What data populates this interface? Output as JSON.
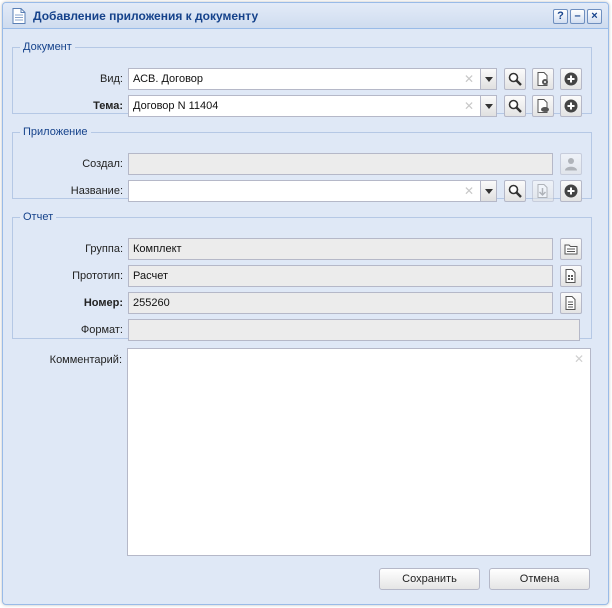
{
  "window": {
    "title": "Добавление приложения к документу"
  },
  "document_group": {
    "legend": "Документ",
    "vid": {
      "label": "Вид:",
      "value": "АСВ. Договор"
    },
    "tema": {
      "label": "Тема:",
      "value": "Договор N 11404"
    }
  },
  "attachment_group": {
    "legend": "Приложение",
    "created_by": {
      "label": "Создал:",
      "value": ""
    },
    "name": {
      "label": "Название:",
      "value": ""
    }
  },
  "report_group": {
    "legend": "Отчет",
    "group": {
      "label": "Группа:",
      "value": "Комплект"
    },
    "prototype": {
      "label": "Прототип:",
      "value": "Расчет"
    },
    "number": {
      "label": "Номер:",
      "value": "255260"
    },
    "format": {
      "label": "Формат:",
      "value": ""
    }
  },
  "comment": {
    "label": "Комментарий:",
    "value": ""
  },
  "buttons": {
    "save": "Сохранить",
    "cancel": "Отмена"
  },
  "colors": {
    "accent": "#15428b",
    "panel_bg": "#dfe8f6",
    "border": "#99bbe8"
  }
}
